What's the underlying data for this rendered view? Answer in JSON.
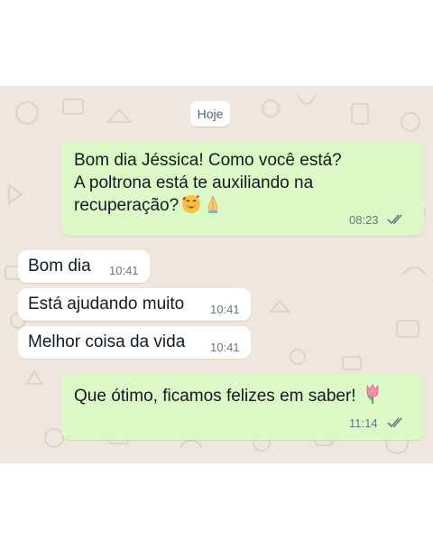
{
  "chat": {
    "date_label": "Hoje",
    "messages": [
      {
        "direction": "outgoing",
        "lines": [
          "Bom dia Jéssica! Como você está?",
          "A poltrona está te auxiliando na",
          "recuperação?"
        ],
        "emojis": [
          "smiling-face-with-hearts",
          "folded-hands"
        ],
        "time": "08:23",
        "status": "read"
      },
      {
        "direction": "incoming",
        "text": "Bom dia",
        "time": "10:41"
      },
      {
        "direction": "incoming",
        "text": "Está ajudando muito",
        "time": "10:41"
      },
      {
        "direction": "incoming",
        "text": "Melhor coisa da vida",
        "time": "10:41"
      },
      {
        "direction": "outgoing",
        "text": "Que ótimo, ficamos felizes em saber!",
        "emojis": [
          "tulip"
        ],
        "time": "11:14",
        "status": "read"
      }
    ]
  },
  "colors": {
    "wallpaper": "#efe7de",
    "outgoing_bubble": "#dcf8c6",
    "incoming_bubble": "#ffffff",
    "read_ticks": "#667781"
  }
}
